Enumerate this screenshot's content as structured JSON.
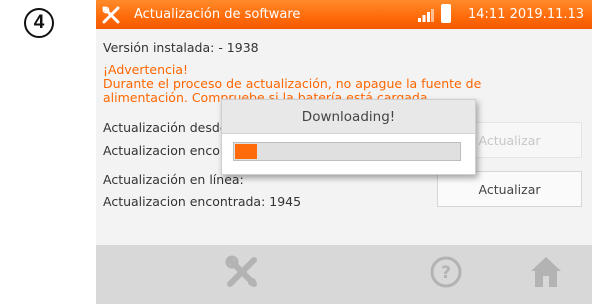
{
  "step": {
    "number": "4"
  },
  "titlebar": {
    "title": "Actualización de software",
    "clock": "14:11 2019.11.13",
    "accent_color": "#ff6a0a",
    "app_icon": "tools-icon"
  },
  "info": {
    "installed_version": "Versión instalada: - 1938",
    "warning_title": "¡Advertencia!",
    "warning_line1": "Durante el proceso de actualización, no apague la fuente de",
    "warning_line2": "alimentación. Compruebe si la batería está cargada."
  },
  "local_update": {
    "label": "Actualización desde USB",
    "found": "Actualizacion encontrada: -",
    "button": "Actualizar",
    "button_enabled": false
  },
  "online_update": {
    "label": "Actualización en línea:",
    "found": "Actualizacion encontrada: 1945",
    "button": "Actualizar",
    "button_enabled": true
  },
  "dialog": {
    "title": "Downloading!",
    "progress_fraction": 0.1
  },
  "footer": {
    "icons": [
      "tools-icon",
      "help-icon",
      "home-icon"
    ]
  }
}
